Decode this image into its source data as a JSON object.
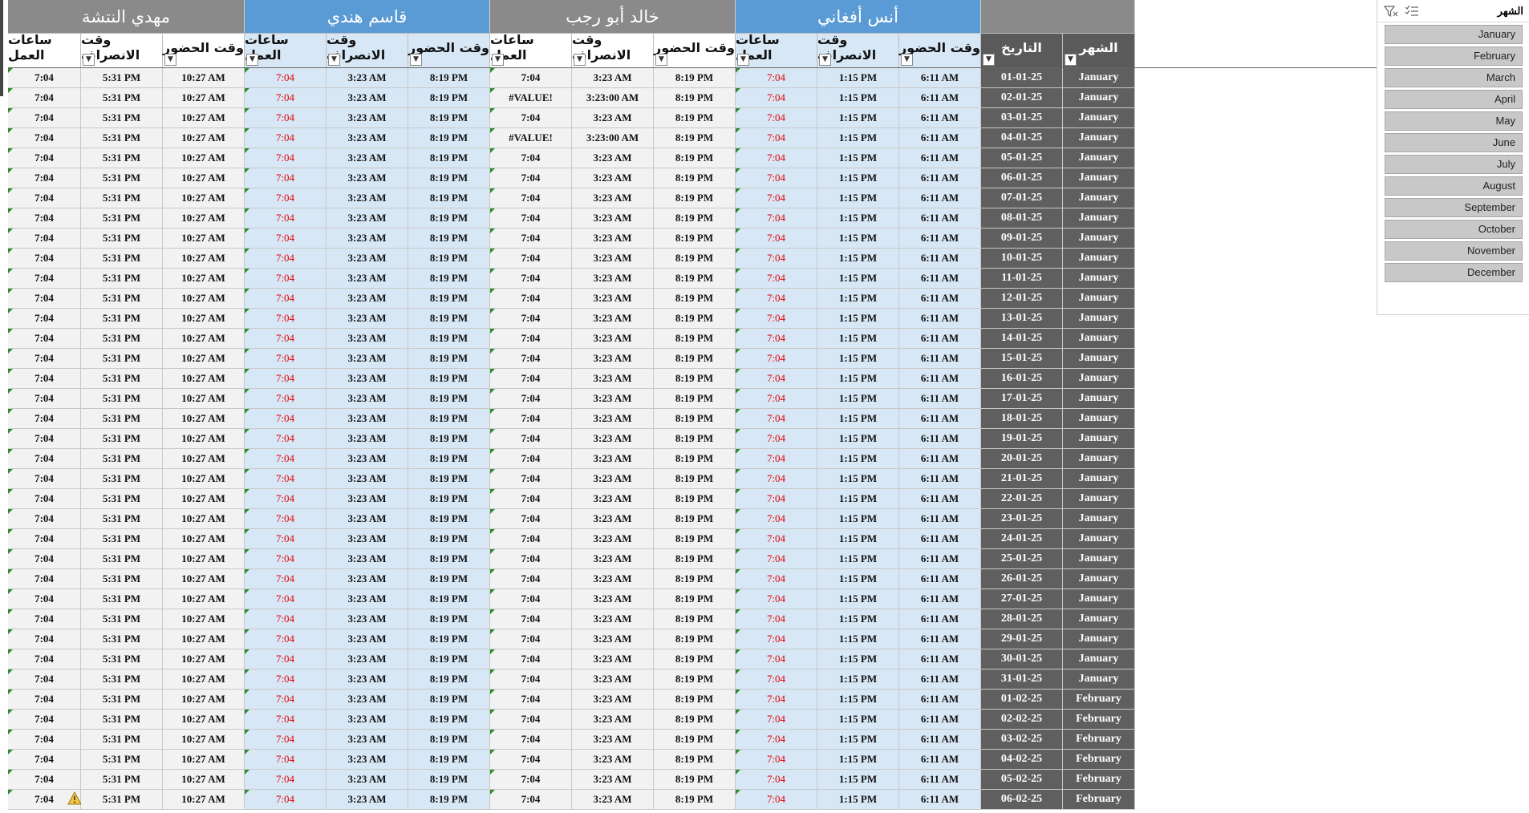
{
  "employees": [
    {
      "name": "مهدي النتشة",
      "color": "grey"
    },
    {
      "name": "قاسم هندي",
      "color": "blue"
    },
    {
      "name": "خالد أبو رجب",
      "color": "grey"
    },
    {
      "name": "أنس أفغاني",
      "color": "blue"
    }
  ],
  "headers": {
    "work_hours": "ساعات العمل",
    "checkout": "وقت الانصراف",
    "checkin": "وقت الحضور",
    "date": "التاريخ",
    "month": "الشهر"
  },
  "defaults": {
    "mahdi": {
      "hours": "7:04",
      "out": "5:31 PM",
      "in": "10:27 AM"
    },
    "qasem": {
      "hours": "7:04",
      "out": "3:23 AM",
      "in": "8:19 PM"
    },
    "khaled": {
      "hours": "7:04",
      "out": "3:23 AM",
      "in": "8:19 PM"
    },
    "anas": {
      "hours": "7:04",
      "out": "1:15 PM",
      "in": "6:11 AM"
    }
  },
  "rows": [
    {
      "date": "01-01-25",
      "month": "January"
    },
    {
      "date": "02-01-25",
      "month": "January",
      "khaled_hours": "#VALUE!",
      "khaled_out": "3:23:00 AM"
    },
    {
      "date": "03-01-25",
      "month": "January"
    },
    {
      "date": "04-01-25",
      "month": "January",
      "khaled_hours": "#VALUE!",
      "khaled_out": "3:23:00 AM"
    },
    {
      "date": "05-01-25",
      "month": "January"
    },
    {
      "date": "06-01-25",
      "month": "January"
    },
    {
      "date": "07-01-25",
      "month": "January"
    },
    {
      "date": "08-01-25",
      "month": "January"
    },
    {
      "date": "09-01-25",
      "month": "January"
    },
    {
      "date": "10-01-25",
      "month": "January"
    },
    {
      "date": "11-01-25",
      "month": "January"
    },
    {
      "date": "12-01-25",
      "month": "January"
    },
    {
      "date": "13-01-25",
      "month": "January"
    },
    {
      "date": "14-01-25",
      "month": "January"
    },
    {
      "date": "15-01-25",
      "month": "January"
    },
    {
      "date": "16-01-25",
      "month": "January"
    },
    {
      "date": "17-01-25",
      "month": "January"
    },
    {
      "date": "18-01-25",
      "month": "January"
    },
    {
      "date": "19-01-25",
      "month": "January"
    },
    {
      "date": "20-01-25",
      "month": "January"
    },
    {
      "date": "21-01-25",
      "month": "January"
    },
    {
      "date": "22-01-25",
      "month": "January"
    },
    {
      "date": "23-01-25",
      "month": "January"
    },
    {
      "date": "24-01-25",
      "month": "January"
    },
    {
      "date": "25-01-25",
      "month": "January"
    },
    {
      "date": "26-01-25",
      "month": "January"
    },
    {
      "date": "27-01-25",
      "month": "January"
    },
    {
      "date": "28-01-25",
      "month": "January"
    },
    {
      "date": "29-01-25",
      "month": "January"
    },
    {
      "date": "30-01-25",
      "month": "January"
    },
    {
      "date": "31-01-25",
      "month": "January"
    },
    {
      "date": "01-02-25",
      "month": "February"
    },
    {
      "date": "02-02-25",
      "month": "February"
    },
    {
      "date": "03-02-25",
      "month": "February"
    },
    {
      "date": "04-02-25",
      "month": "February"
    },
    {
      "date": "05-02-25",
      "month": "February"
    },
    {
      "date": "06-02-25",
      "month": "February"
    }
  ],
  "slicer": {
    "title": "الشهر",
    "items": [
      "January",
      "February",
      "March",
      "April",
      "May",
      "June",
      "July",
      "August",
      "September",
      "October",
      "November",
      "December"
    ]
  },
  "colors": {
    "grey_header": "#8a8a8a",
    "blue_header": "#5b9bd5",
    "blue_cell": "#d8e7f6",
    "red_text": "#e00000"
  }
}
